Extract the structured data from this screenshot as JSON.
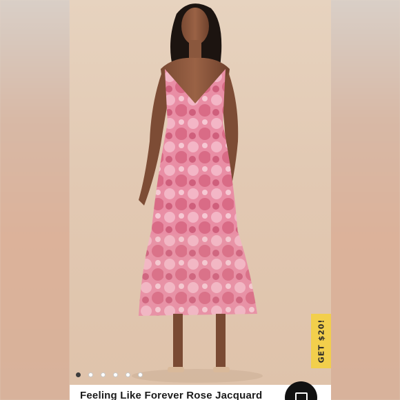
{
  "product": {
    "title": "Feeling Like Forever Rose Jacquard"
  },
  "promo": {
    "label": "GET $20!"
  },
  "carousel": {
    "total": 6,
    "active_index": 0
  },
  "icons": {
    "like": "heart-icon",
    "action": "square-icon"
  },
  "colors": {
    "promo_bg": "#f2cf4c",
    "dress": "#e58fa3",
    "backdrop": "#e2c9b3"
  }
}
